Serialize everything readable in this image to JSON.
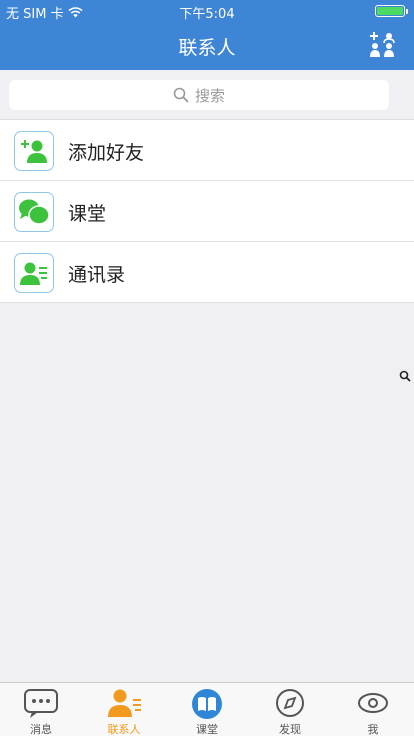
{
  "status": {
    "carrier": "无 SIM 卡",
    "time": "下午5:04",
    "battery_level": 1.0
  },
  "nav": {
    "title": "联系人",
    "action_icon": "add-contacts-icon"
  },
  "search": {
    "placeholder": "搜索",
    "icon": "search-icon"
  },
  "list": {
    "items": [
      {
        "label": "添加好友",
        "icon": "add-friend-icon"
      },
      {
        "label": "课堂",
        "icon": "chat-bubbles-icon"
      },
      {
        "label": "通讯录",
        "icon": "contact-card-icon"
      }
    ]
  },
  "tabs": [
    {
      "label": "消息",
      "icon": "message-icon",
      "active": false
    },
    {
      "label": "联系人",
      "icon": "contacts-icon",
      "active": true
    },
    {
      "label": "课堂",
      "icon": "book-icon",
      "active": false
    },
    {
      "label": "发现",
      "icon": "compass-icon",
      "active": false
    },
    {
      "label": "我",
      "icon": "profile-icon",
      "active": false
    }
  ],
  "colors": {
    "brand_blue": "#3f85d6",
    "icon_green": "#3cc23c",
    "active_tab": "#f29a1f",
    "background": "#efeff4"
  }
}
